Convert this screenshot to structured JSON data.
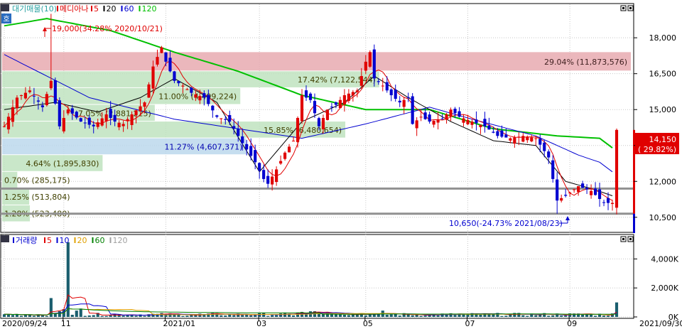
{
  "legend_top": {
    "mode_label": "호",
    "volume_profile_label": "대기매물(10)",
    "title": "메디아나",
    "ma_labels": [
      "5",
      "20",
      "60",
      "120"
    ],
    "ma_colors": [
      "#e00000",
      "#000000",
      "#0000d0",
      "#00c000"
    ]
  },
  "legend_bottom": {
    "title": "거래량",
    "ma_labels": [
      "5",
      "10",
      "20",
      "60",
      "120"
    ],
    "ma_colors": [
      "#e00000",
      "#0000d0",
      "#e0a000",
      "#008000",
      "#a0a0a0"
    ]
  },
  "colors": {
    "up": "#e00000",
    "down": "#0000d0",
    "current_price_box": "#e00000"
  },
  "annotations": {
    "high": "19,000(34.28% 2020/10/21)",
    "low": "10,650(-24.73% 2021/08/23)",
    "current_price": "14,150",
    "current_change": "( 29.82%)"
  },
  "chart_data": [
    {
      "type": "candlestick",
      "price_axis": {
        "min": 9900,
        "max": 19400,
        "ticks": [
          "18,000",
          "16,500",
          "15,000",
          "13,500",
          "12,000",
          "10,500"
        ],
        "tick_values": [
          18000,
          16500,
          15000,
          13500,
          12000,
          10500
        ]
      },
      "x_axis": {
        "labels": [
          "2020/09/24",
          "11",
          "2021/01",
          "03",
          "05",
          "07",
          "09",
          "2021/09/30"
        ]
      },
      "volume_profile": [
        {
          "price_low": 16600,
          "price_high": 17400,
          "label": "29.04% (11,873,576)"
        },
        {
          "price_low": 15900,
          "price_high": 16600,
          "label": "17.42% (7,122,544)"
        },
        {
          "price_low": 15200,
          "price_high": 15900,
          "label": "11.00% (4,499,224)"
        },
        {
          "price_low": 14500,
          "price_high": 15200,
          "label": "7.05% (2,881,225)"
        },
        {
          "price_low": 13800,
          "price_high": 14500,
          "label": "15.85% (6,480,654)"
        },
        {
          "price_low": 13100,
          "price_high": 13800,
          "label": "11.27% (4,607,371)"
        },
        {
          "price_low": 12400,
          "price_high": 13100,
          "label": "4.64% (1,895,830)"
        },
        {
          "price_low": 11700,
          "price_high": 12400,
          "label": "0.70% (285,175)"
        },
        {
          "price_low": 11000,
          "price_high": 11700,
          "label": "1.25% (513,804)"
        },
        {
          "price_low": 10300,
          "price_high": 11000,
          "label": "1.28% (523,480)"
        }
      ],
      "reference_lines": [
        11700,
        10650
      ],
      "price_path": [
        [
          0,
          14300
        ],
        [
          3,
          15500
        ],
        [
          6,
          15800
        ],
        [
          9,
          15100
        ],
        [
          11,
          16200
        ],
        [
          13,
          14300
        ],
        [
          15,
          15000
        ],
        [
          18,
          14500
        ],
        [
          21,
          14300
        ],
        [
          24,
          14800
        ],
        [
          26,
          14500
        ],
        [
          28,
          14400
        ],
        [
          30,
          14800
        ],
        [
          33,
          15300
        ],
        [
          35,
          16800
        ],
        [
          37,
          17600
        ],
        [
          38,
          17000
        ],
        [
          40,
          16200
        ],
        [
          42,
          16000
        ],
        [
          44,
          15700
        ],
        [
          47,
          15500
        ],
        [
          50,
          14700
        ],
        [
          53,
          14500
        ],
        [
          56,
          13600
        ],
        [
          59,
          12800
        ],
        [
          61,
          12100
        ],
        [
          62,
          11900
        ],
        [
          64,
          12500
        ],
        [
          66,
          13200
        ],
        [
          68,
          13700
        ],
        [
          70,
          15600
        ],
        [
          72,
          15400
        ],
        [
          74,
          14300
        ],
        [
          76,
          15000
        ],
        [
          78,
          15200
        ],
        [
          80,
          15600
        ],
        [
          83,
          15800
        ],
        [
          85,
          17000
        ],
        [
          86,
          17400
        ],
        [
          87,
          16300
        ],
        [
          89,
          16000
        ],
        [
          91,
          15600
        ],
        [
          93,
          15300
        ],
        [
          95,
          15500
        ],
        [
          96,
          14400
        ],
        [
          98,
          14700
        ],
        [
          100,
          14500
        ],
        [
          103,
          14600
        ],
        [
          105,
          15000
        ],
        [
          107,
          14700
        ],
        [
          110,
          14500
        ],
        [
          113,
          14300
        ],
        [
          116,
          13900
        ],
        [
          119,
          13800
        ],
        [
          122,
          13900
        ],
        [
          125,
          13800
        ],
        [
          128,
          13000
        ],
        [
          130,
          11200
        ],
        [
          132,
          11400
        ],
        [
          135,
          11800
        ],
        [
          138,
          11600
        ],
        [
          141,
          11100
        ],
        [
          143,
          11100
        ],
        [
          144,
          14150
        ]
      ],
      "price_extremes": [
        {
          "index": 11,
          "high": 19000
        },
        {
          "index": 130,
          "low": 10650
        }
      ],
      "ma_values": {
        "ma120": [
          [
            0,
            18500
          ],
          [
            10,
            18800
          ],
          [
            25,
            18300
          ],
          [
            40,
            17400
          ],
          [
            55,
            16600
          ],
          [
            70,
            15600
          ],
          [
            85,
            15000
          ],
          [
            100,
            15000
          ],
          [
            115,
            14200
          ],
          [
            130,
            13900
          ],
          [
            140,
            13800
          ],
          [
            143,
            13400
          ]
        ],
        "ma60": [
          [
            0,
            17300
          ],
          [
            20,
            15500
          ],
          [
            40,
            14600
          ],
          [
            55,
            14200
          ],
          [
            70,
            13800
          ],
          [
            85,
            14400
          ],
          [
            100,
            15100
          ],
          [
            110,
            14600
          ],
          [
            125,
            13900
          ],
          [
            135,
            13100
          ],
          [
            140,
            12800
          ],
          [
            143,
            12400
          ]
        ],
        "ma20": [
          [
            0,
            15000
          ],
          [
            12,
            15300
          ],
          [
            22,
            14900
          ],
          [
            32,
            15500
          ],
          [
            40,
            16300
          ],
          [
            50,
            15300
          ],
          [
            60,
            12400
          ],
          [
            70,
            14500
          ],
          [
            80,
            15300
          ],
          [
            87,
            16400
          ],
          [
            95,
            15500
          ],
          [
            105,
            14500
          ],
          [
            115,
            13700
          ],
          [
            125,
            13500
          ],
          [
            132,
            12000
          ],
          [
            138,
            11700
          ],
          [
            143,
            11400
          ]
        ]
      },
      "volume_axis": {
        "max": 5000000,
        "ticks": [
          "4,000K",
          "2,000K",
          "0K"
        ],
        "tick_values": [
          4000000,
          2000000,
          0
        ]
      },
      "volume_spikes": [
        {
          "index": 15,
          "value": 5150000
        },
        {
          "index": 11,
          "value": 1300000
        },
        {
          "index": 144,
          "value": 1000000
        }
      ]
    }
  ]
}
